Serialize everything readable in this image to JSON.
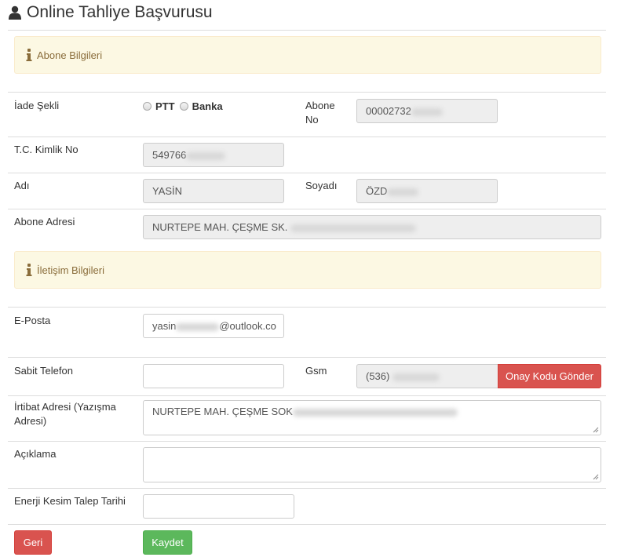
{
  "page": {
    "title": "Online Tahliye Başvurusu"
  },
  "sections": {
    "abone": "Abone Bilgileri",
    "iletisim": "İletişim Bilgileri"
  },
  "form": {
    "iade_sekli": {
      "label": "İade Şekli",
      "options": [
        "PTT",
        "Banka"
      ]
    },
    "abone_no": {
      "label_line1": "Abone",
      "label_line2": "No",
      "value": "00002732"
    },
    "tc": {
      "label": "T.C. Kimlik No",
      "value": "549766"
    },
    "adi": {
      "label": "Adı",
      "value": "YASİN"
    },
    "soyadi": {
      "label": "Soyadı",
      "value": "ÖZD"
    },
    "abone_adresi": {
      "label": "Abone Adresi",
      "value": "NURTEPE MAH. ÇEŞME SK."
    },
    "eposta": {
      "label": "E-Posta",
      "value_start": "yasin",
      "value_end": "@outlook.co"
    },
    "sabit_tel": {
      "label": "Sabit Telefon",
      "value": ""
    },
    "gsm": {
      "label": "Gsm",
      "value": "(536)",
      "button": "Onay Kodu Gönder"
    },
    "irtibat": {
      "label_line1": "İrtibat Adresi (Yazışma",
      "label_line2": "Adresi)",
      "value": "NURTEPE MAH. ÇEŞME SOK"
    },
    "aciklama": {
      "label": "Açıklama",
      "value": ""
    },
    "enerji": {
      "label": "Enerji Kesim Talep Tarihi",
      "value": ""
    }
  },
  "buttons": {
    "back": "Geri",
    "save": "Kaydet"
  },
  "colors": {
    "danger": "#d9534f",
    "success": "#5cb85c",
    "warning_bg": "#fcf8e3",
    "warning_text": "#8a6d3b"
  }
}
